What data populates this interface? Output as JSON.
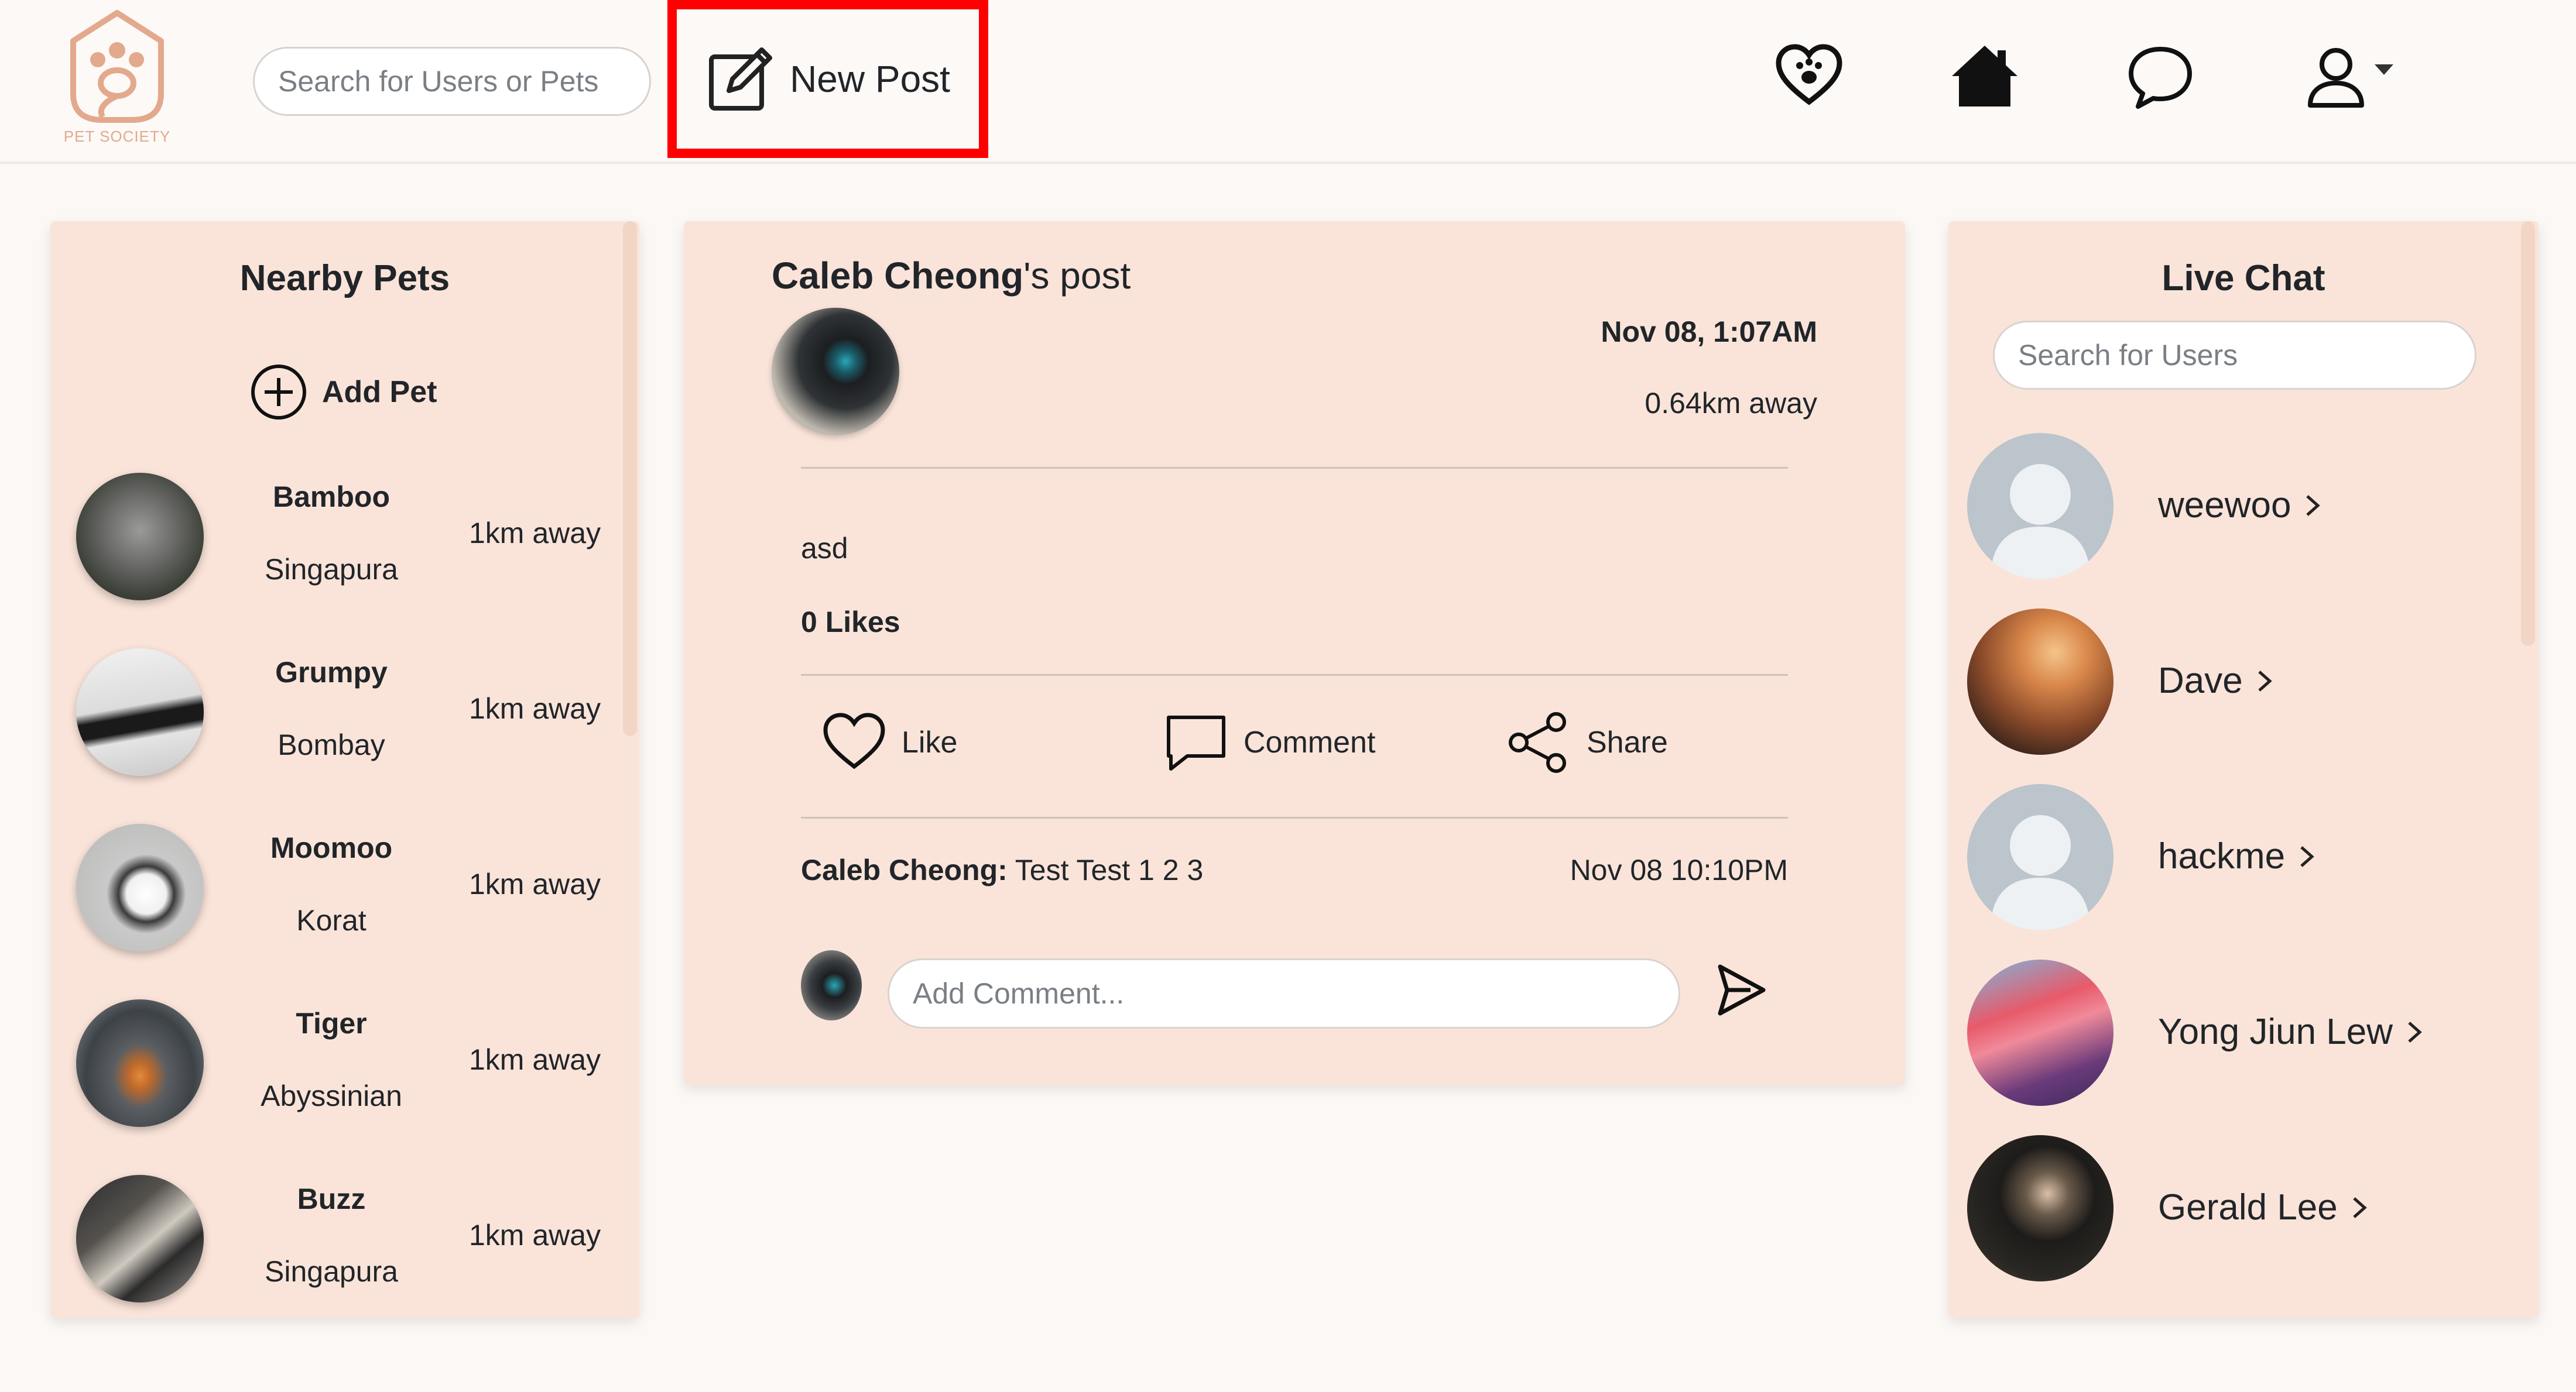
{
  "navbar": {
    "logo_text": "PET SOCIETY",
    "search_placeholder": "Search for Users or Pets",
    "new_post_label": "New Post",
    "icons": [
      "heart-paw-icon",
      "home-icon",
      "chat-bubble-icon",
      "user-icon"
    ]
  },
  "nearby": {
    "title": "Nearby Pets",
    "add_pet_label": "Add Pet",
    "pets": [
      {
        "name": "Bamboo",
        "breed": "Singapura",
        "distance": "1km away"
      },
      {
        "name": "Grumpy",
        "breed": "Bombay",
        "distance": "1km away"
      },
      {
        "name": "Moomoo",
        "breed": "Korat",
        "distance": "1km away"
      },
      {
        "name": "Tiger",
        "breed": "Abyssinian",
        "distance": "1km away"
      },
      {
        "name": "Buzz",
        "breed": "Singapura",
        "distance": "1km away"
      }
    ]
  },
  "post": {
    "author": "Caleb Cheong",
    "title_suffix": "'s post",
    "date": "Nov 08, 1:07AM",
    "distance": "0.64km away",
    "content": "asd",
    "likes": "0 Likes",
    "actions": {
      "like": "Like",
      "comment": "Comment",
      "share": "Share"
    },
    "comment": {
      "author": "Caleb Cheong:",
      "text": " Test Test 1 2 3",
      "date": "Nov 08 10:10PM"
    },
    "comment_placeholder": "Add Comment..."
  },
  "chat": {
    "title": "Live Chat",
    "search_placeholder": "Search for Users",
    "users": [
      {
        "name": "weewoo"
      },
      {
        "name": "Dave"
      },
      {
        "name": "hackme"
      },
      {
        "name": "Yong Jiun Lew"
      },
      {
        "name": "Gerald Lee"
      }
    ]
  },
  "colors": {
    "panel_bg": "#fae4d9",
    "page_bg": "#fcf8f6",
    "highlight": "#ff0000",
    "logo": "#e3a98d"
  }
}
